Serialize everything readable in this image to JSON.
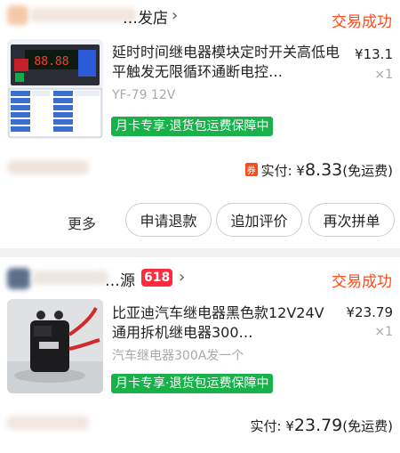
{
  "orders": [
    {
      "shop_name": "…发店",
      "status": "交易成功",
      "item": {
        "title": "延时时间继电器模块定时开关高低电平触发无限循环通断电控…",
        "spec": "YF-79 12V",
        "price": "¥13.1",
        "qty": "×1",
        "promo": "月卡专享·退货包运费保障中"
      },
      "payment": {
        "coupon_label": "券",
        "label": "实付:",
        "currency": "¥",
        "amount": "8.33",
        "note": "(免运费)"
      },
      "actions": {
        "more": "更多",
        "buttons": [
          "申请退款",
          "追加评价",
          "再次拼单"
        ]
      }
    },
    {
      "shop_name": "…源",
      "badge": "618",
      "status": "交易成功",
      "item": {
        "title": "比亚迪汽车继电器黑色款12V24V通用拆机继电器300…",
        "spec": "汽车继电器300A发一个",
        "price": "¥23.79",
        "qty": "×1",
        "promo": "月卡专享·退货包运费保障中"
      },
      "payment": {
        "label": "实付:",
        "currency": "¥",
        "amount": "23.79",
        "note": "(免运费)"
      }
    }
  ],
  "colors": {
    "accent": "#ff4a1a",
    "promo_green": "#19b24a",
    "muted": "#a9a9a9"
  },
  "icons": [
    "chevron-right-icon",
    "coupon-icon",
    "shop-avatar"
  ]
}
